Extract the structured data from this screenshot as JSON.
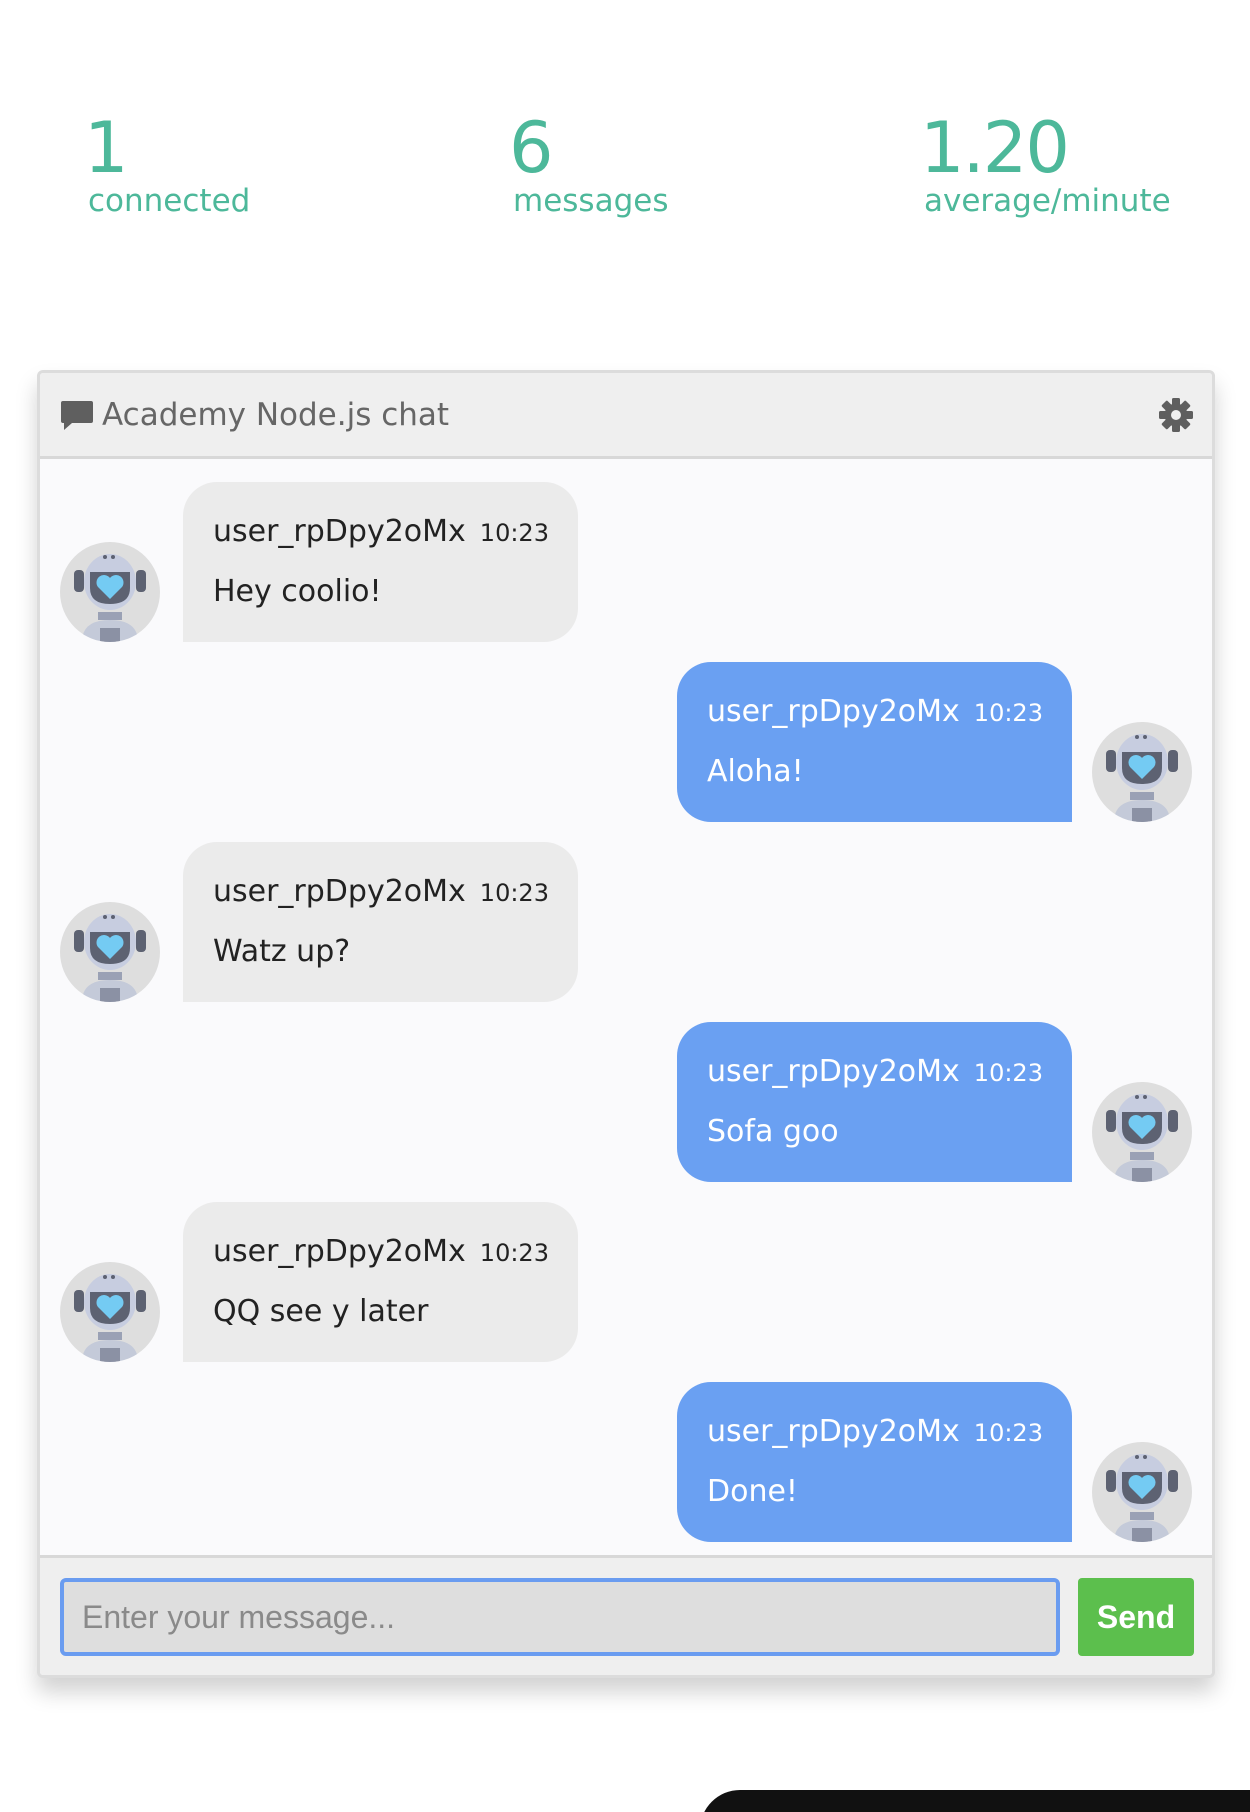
{
  "stats": {
    "connected": {
      "value": "1",
      "label": "connected"
    },
    "messages": {
      "value": "6",
      "label": "messages"
    },
    "average": {
      "value": "1.20",
      "label": "average/minute"
    }
  },
  "chat": {
    "title": "Academy Node.js chat",
    "title_icon": "chat-bubble-icon",
    "settings_icon": "gear-icon",
    "messages": [
      {
        "direction": "in",
        "user": "user_rpDpy2oMx",
        "time": "10:23",
        "text": "Hey coolio!"
      },
      {
        "direction": "out",
        "user": "user_rpDpy2oMx",
        "time": "10:23",
        "text": "Aloha!"
      },
      {
        "direction": "in",
        "user": "user_rpDpy2oMx",
        "time": "10:23",
        "text": "Watz up?"
      },
      {
        "direction": "out",
        "user": "user_rpDpy2oMx",
        "time": "10:23",
        "text": "Sofa goo"
      },
      {
        "direction": "in",
        "user": "user_rpDpy2oMx",
        "time": "10:23",
        "text": "QQ see y later"
      },
      {
        "direction": "out",
        "user": "user_rpDpy2oMx",
        "time": "10:23",
        "text": "Done!"
      }
    ],
    "avatar_icon": "robot-avatar-icon",
    "input": {
      "value": "",
      "placeholder": "Enter your message..."
    },
    "send_label": "Send"
  },
  "colors": {
    "accent": "#4db89a",
    "outgoing_bubble": "#6aa0f2",
    "incoming_bubble": "#ebebeb",
    "send_button": "#5cbf4d"
  }
}
